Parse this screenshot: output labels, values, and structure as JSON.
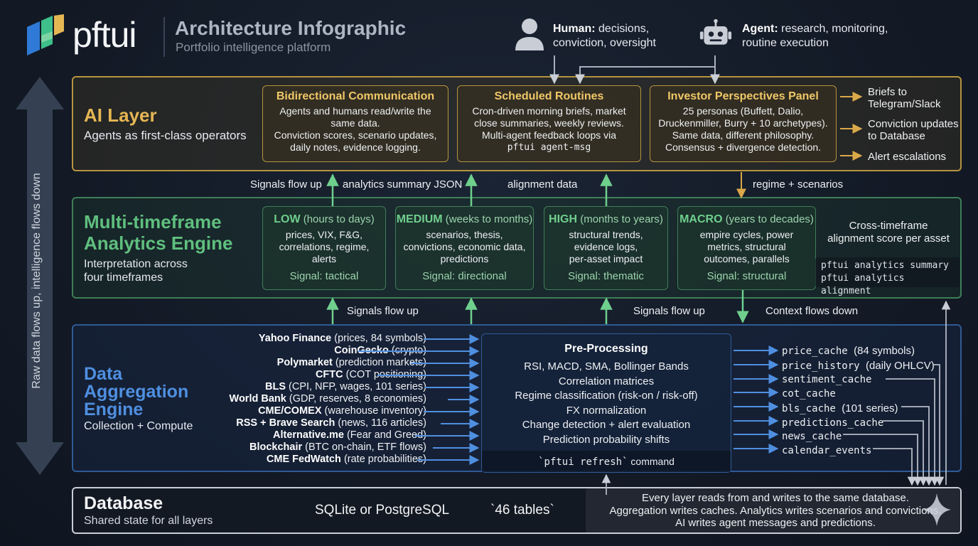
{
  "header": {
    "brand": "pftui",
    "title": "Architecture Infographic",
    "subtitle": "Portfolio intelligence platform",
    "human": {
      "label": "Human:",
      "desc_line1": "decisions,",
      "desc_line2": "conviction, oversight",
      "icon": "person-icon"
    },
    "agent": {
      "label": "Agent:",
      "desc_line1": "research, monitoring,",
      "desc_line2": "routine execution",
      "icon": "robot-icon"
    }
  },
  "side_label": "Raw data flows up, intelligence flows down",
  "ai_layer": {
    "title": "AI Layer",
    "subtitle": "Agents as first-class operators",
    "boxes": [
      {
        "title": "Bidirectional Communication",
        "lines": [
          "Agents and humans read/write the",
          "same data.",
          "Conviction scores, scenario updates,",
          "daily notes, evidence logging."
        ]
      },
      {
        "title": "Scheduled Routines",
        "lines": [
          "Cron-driven morning briefs, market",
          "close summaries, weekly reviews.",
          "Multi-agent feedback loops via"
        ],
        "cmd": "pftui agent-msg"
      },
      {
        "title": "Investor Perspectives Panel",
        "lines": [
          "25 personas (Buffett, Dalio,",
          "Druckenmiller, Burry + 10 archetypes).",
          "Same data, different philosophy.",
          "Consensus + divergence detection."
        ]
      }
    ],
    "outputs": [
      {
        "line1": "Briefs to",
        "line2": "Telegram/Slack"
      },
      {
        "line1": "Conviction updates",
        "line2": "to Database"
      },
      {
        "line1": "Alert escalations",
        "line2": ""
      }
    ]
  },
  "flows_upper": {
    "signals_up": "Signals flow up",
    "analytics_json": "analytics summary JSON",
    "alignment": "alignment data",
    "regime": "regime + scenarios"
  },
  "analytics_layer": {
    "title_line1": "Multi-timeframe",
    "title_line2": "Analytics Engine",
    "subtitle_line1": "Interpretation across",
    "subtitle_line2": "four timeframes",
    "timeframes": [
      {
        "name": "LOW",
        "range": "(hours to days)",
        "lines": [
          "prices, VIX, F&G,",
          "correlations, regime,",
          "alerts"
        ],
        "signal": "Signal: tactical"
      },
      {
        "name": "MEDIUM",
        "range": "(weeks to months)",
        "lines": [
          "scenarios, thesis,",
          "convictions, economic data,",
          "predictions"
        ],
        "signal": "Signal: directional"
      },
      {
        "name": "HIGH",
        "range": "(months to years)",
        "lines": [
          "structural trends,",
          "evidence logs,",
          "per-asset impact"
        ],
        "signal": "Signal: thematic"
      },
      {
        "name": "MACRO",
        "range": "(years to decades)",
        "lines": [
          "empire cycles, power",
          "metrics, structural",
          "outcomes, parallels"
        ],
        "signal": "Signal: structural"
      }
    ],
    "cross_line1": "Cross-timeframe",
    "cross_line2": "alignment score per asset",
    "commands": [
      "pftui analytics summary",
      "pftui analytics alignment"
    ]
  },
  "flows_lower": {
    "signals_up_left": "Signals flow up",
    "signals_up_right": "Signals flow up",
    "context_down": "Context flows down"
  },
  "aggregation_layer": {
    "title_line1": "Data",
    "title_line2": "Aggregation",
    "title_line3": "Engine",
    "subtitle": "Collection + Compute",
    "sources": [
      {
        "name": "Yahoo Finance",
        "desc": "(prices, 84 symbols)"
      },
      {
        "name": "CoinGecko",
        "desc": "(crypto)"
      },
      {
        "name": "Polymarket",
        "desc": "(prediction markets)"
      },
      {
        "name": "CFTC",
        "desc": "(COT positioning)"
      },
      {
        "name": "BLS",
        "desc": "(CPI, NFP, wages, 101 series)"
      },
      {
        "name": "World Bank",
        "desc": "(GDP, reserves, 8 economies)"
      },
      {
        "name": "CME/COMEX",
        "desc": "(warehouse inventory)"
      },
      {
        "name": "RSS + Brave Search",
        "desc": "(news, 116 articles)"
      },
      {
        "name": "Alternative.me",
        "desc": "(Fear and Greed)"
      },
      {
        "name": "Blockchair",
        "desc": "(BTC on-chain, ETF flows)"
      },
      {
        "name": "CME FedWatch",
        "desc": "(rate probabilities)"
      }
    ],
    "preprocessing": {
      "title": "Pre-Processing",
      "lines": [
        "RSI, MACD, SMA, Bollinger Bands",
        "Correlation matrices",
        "Regime classification (risk-on / risk-off)",
        "FX normalization",
        "Change detection + alert evaluation",
        "Prediction probability shifts"
      ],
      "cmd": "`pftui refresh`",
      "cmd_suffix": "command"
    },
    "caches": [
      {
        "name": "price_cache",
        "note": "(84 symbols)"
      },
      {
        "name": "price_history",
        "note": "(daily OHLCV)"
      },
      {
        "name": "sentiment_cache",
        "note": ""
      },
      {
        "name": "cot_cache",
        "note": ""
      },
      {
        "name": "bls_cache",
        "note": "(101 series)"
      },
      {
        "name": "predictions_cache",
        "note": ""
      },
      {
        "name": "news_cache",
        "note": ""
      },
      {
        "name": "calendar_events",
        "note": ""
      }
    ]
  },
  "database": {
    "title": "Database",
    "subtitle": "Shared state for all layers",
    "engine": "SQLite or PostgreSQL",
    "tables": "`46 tables`",
    "notes": [
      "Every layer reads from and writes to the same database.",
      "Aggregation writes caches. Analytics writes scenarios and convictions.",
      "AI writes agent messages and predictions."
    ]
  },
  "colors": {
    "ai": "#b5933f",
    "analytics": "#3e7e57",
    "aggregation": "#2f5b95",
    "database": "#c9ced6"
  }
}
